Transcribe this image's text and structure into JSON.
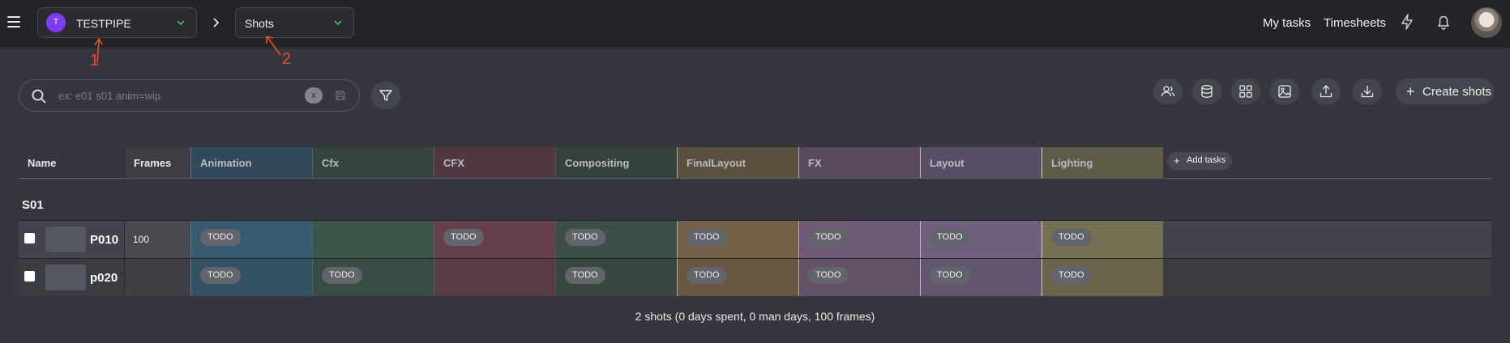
{
  "topbar": {
    "production_initial": "T",
    "production_name": "TESTPIPE",
    "section_name": "Shots",
    "my_tasks": "My tasks",
    "timesheets": "Timesheets",
    "icons": [
      "menu-icon",
      "chevron-down-icon",
      "chevron-right-icon",
      "lightning-icon",
      "bell-icon",
      "user-avatar"
    ]
  },
  "annotations": {
    "one": "1",
    "two": "2",
    "color": "#f04a23"
  },
  "toolbar": {
    "search_placeholder": "ex: e01 s01 anim=wip",
    "clear_label": "x",
    "create_shots": "Create shots",
    "icons": [
      "people-icon",
      "database-icon",
      "grid-icon",
      "image-icon",
      "upload-icon",
      "download-icon"
    ]
  },
  "table": {
    "columns": {
      "name": "Name",
      "frames": "Frames",
      "tasks": [
        {
          "label": "Animation",
          "color": "#1e8fc3"
        },
        {
          "label": "Cfx",
          "color": "#2f7d44"
        },
        {
          "label": "CFX",
          "color": "#b23a4e"
        },
        {
          "label": "Compositing",
          "color": "#2e6b3c"
        },
        {
          "label": "FinalLayout",
          "color": "#e0a73f"
        },
        {
          "label": "FX",
          "color": "#d58fd6"
        },
        {
          "label": "Layout",
          "color": "#d7a7f2"
        },
        {
          "label": "Lighting",
          "color": "#e8d962"
        }
      ],
      "add_tasks": "Add tasks"
    },
    "group": "S01",
    "rows": [
      {
        "name": "P010",
        "frames": "100",
        "tasks": [
          "TODO",
          "",
          "TODO",
          "TODO",
          "TODO",
          "TODO",
          "TODO",
          "TODO"
        ]
      },
      {
        "name": "p020",
        "frames": "",
        "tasks": [
          "TODO",
          "TODO",
          "",
          "TODO",
          "TODO",
          "TODO",
          "TODO",
          "TODO"
        ]
      }
    ]
  },
  "footer": {
    "summary": "2 shots (0 days spent, 0 man days, 100 frames)"
  }
}
